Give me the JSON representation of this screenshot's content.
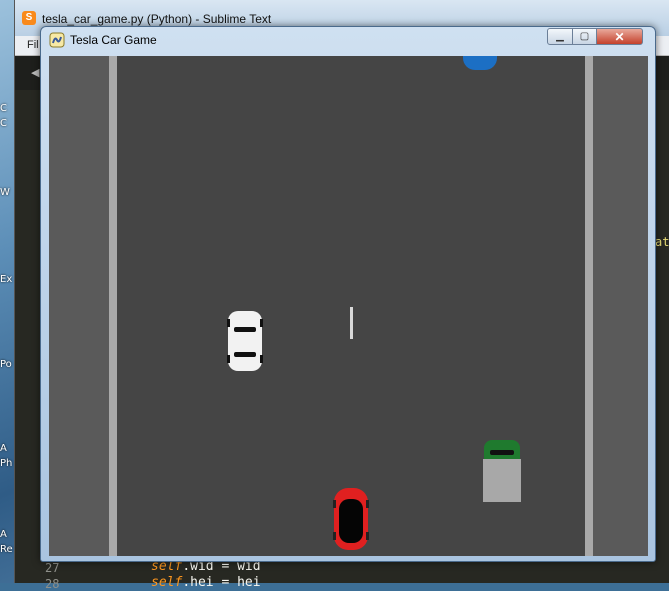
{
  "sublime": {
    "title": "tesla_car_game.py (Python) - Sublime Text",
    "menu_first": "Fil",
    "tab_arrow": "◀",
    "gutter": [
      "27",
      "28"
    ],
    "code": [
      {
        "kw": "self",
        "rest": ".wid = wid"
      },
      {
        "kw": "self",
        "rest": ".hei = hei"
      }
    ],
    "side_fragment": "at"
  },
  "desktop_labels": [
    "C",
    "C",
    "W",
    "Ex",
    "Po",
    "A",
    "Ph",
    "A",
    "Re"
  ],
  "pygame_window": {
    "title": "Tesla Car Game",
    "buttons": {
      "minimize": "▁",
      "maximize": "▢",
      "close": "✕"
    }
  },
  "game": {
    "road_color": "#454545",
    "shoulder_color": "#5a5a5a",
    "edge_line_color": "#a9a9a9",
    "cars": [
      {
        "name": "player-car-red",
        "color": "#e02020",
        "role": "player"
      },
      {
        "name": "enemy-car-white",
        "color": "#f2f2f2",
        "role": "traffic"
      },
      {
        "name": "enemy-car-blue",
        "color": "#1c6fc4",
        "role": "traffic"
      },
      {
        "name": "enemy-truck-green",
        "color": "#1f7a2e",
        "cargo_color": "#a8a8a8",
        "role": "traffic"
      }
    ]
  }
}
